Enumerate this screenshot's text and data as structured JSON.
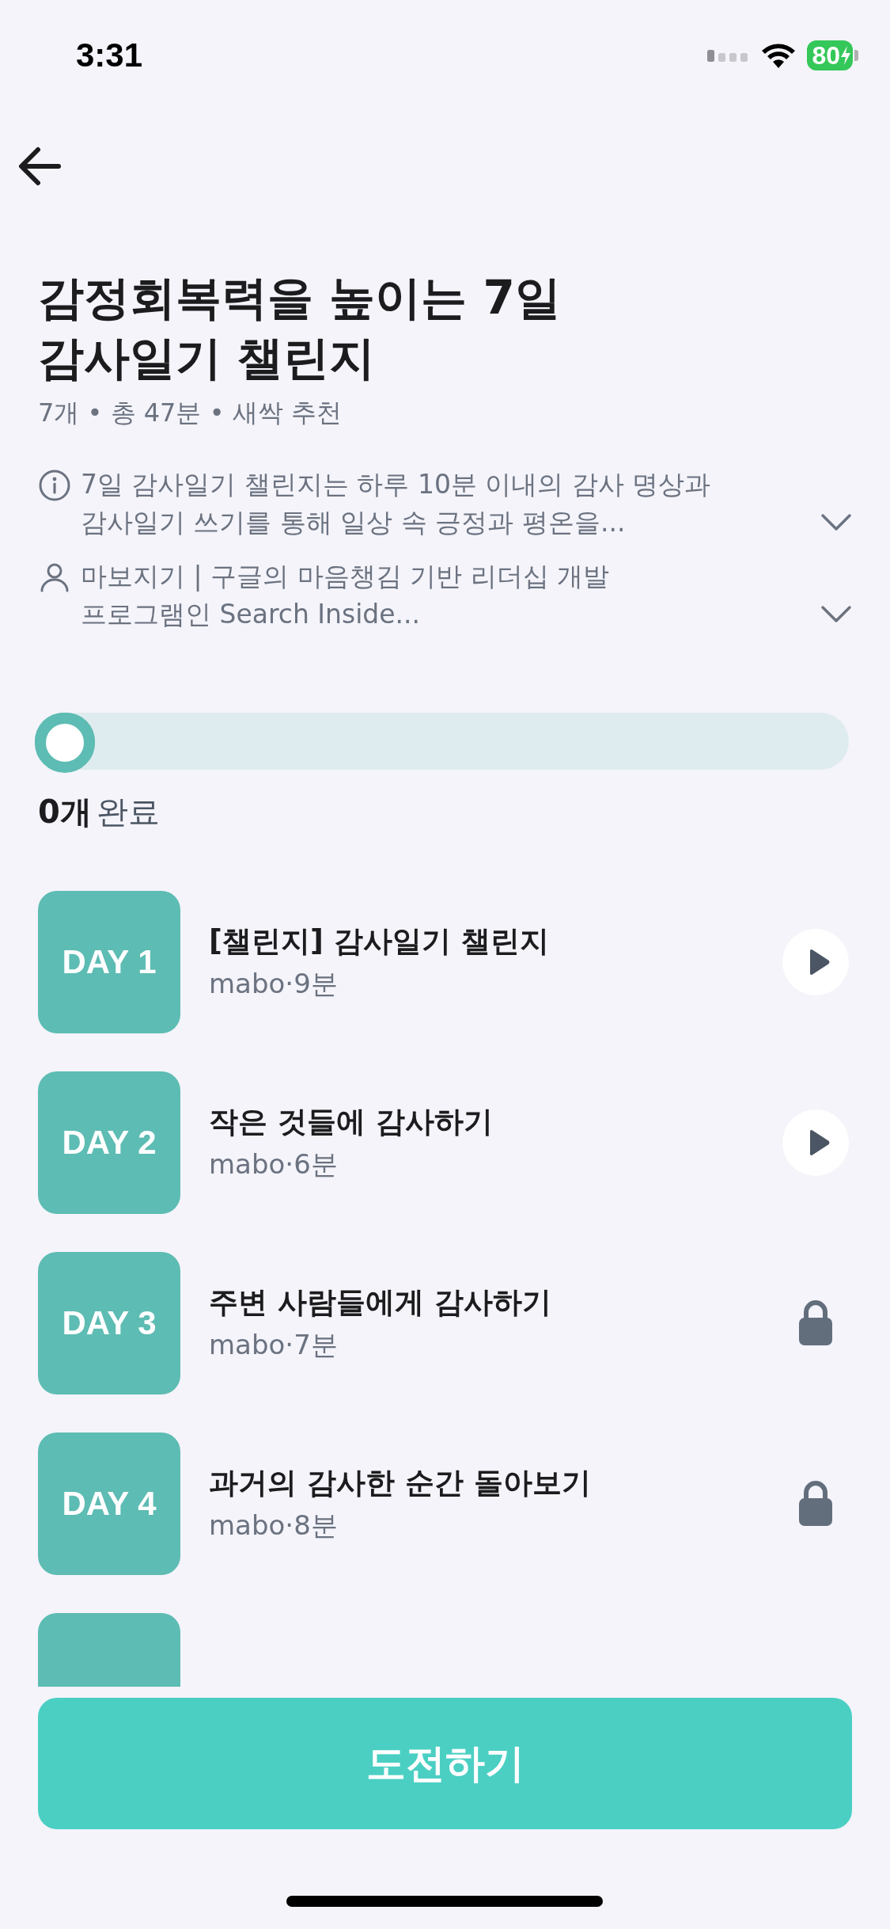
{
  "status_bar": {
    "time": "3:31",
    "battery": "80"
  },
  "title": "감정회복력을 높이는 7일\n감사일기 챌린지",
  "meta": "7개 • 총 47분 • 새싹 추천",
  "info": [
    {
      "kind": "info",
      "text": "7일 감사일기 챌린지는 하루 10분 이내의 감사 명상과\n감사일기 쓰기를 통해 일상 속 긍정과 평온을...",
      "expanded": false
    },
    {
      "kind": "person",
      "text": "마보지기  | 구글의 마음챙김 기반 리더십 개발\n프로그램인 Search Inside...",
      "expanded": false
    }
  ],
  "progress": {
    "level": 0,
    "count": "0개",
    "label": "완료"
  },
  "sessions": [
    {
      "day": "DAY 1",
      "title": "[챌린지] 감사일기 챌린지",
      "sub": "mabo·9분",
      "kind": "play"
    },
    {
      "day": "DAY 2",
      "title": "작은 것들에 감사하기",
      "sub": "mabo·6분",
      "kind": "play"
    },
    {
      "day": "DAY 3",
      "title": "주변 사람들에게 감사하기",
      "sub": "mabo·7분",
      "kind": "locked"
    },
    {
      "day": "DAY 4",
      "title": "과거의 감사한 순간 돌아보기",
      "sub": "mabo·8분",
      "kind": "locked"
    }
  ],
  "button": "도전하기"
}
